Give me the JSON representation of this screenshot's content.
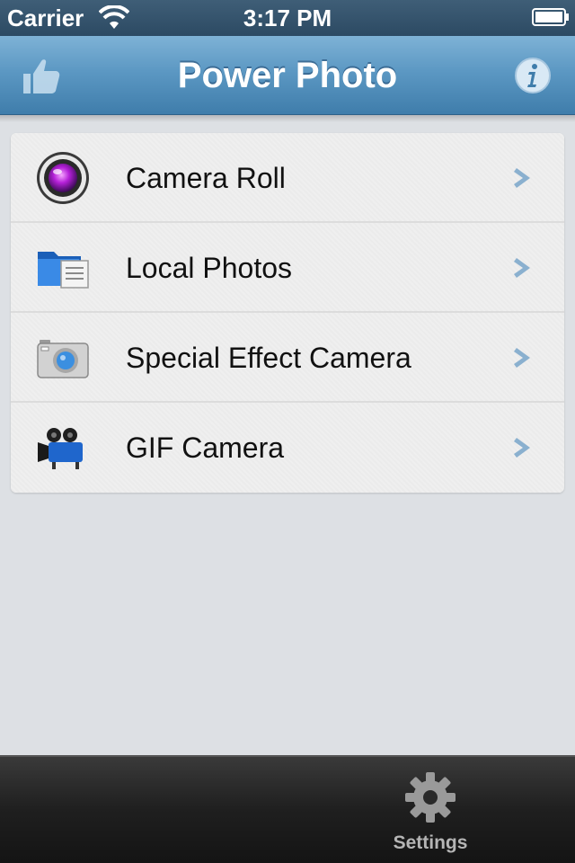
{
  "status_bar": {
    "carrier": "Carrier",
    "time": "3:17 PM"
  },
  "nav_bar": {
    "title": "Power Photo",
    "left_icon": "thumbs-up-icon",
    "right_icon": "info-icon"
  },
  "menu": {
    "items": [
      {
        "label": "Camera Roll",
        "icon": "camera-lens-icon"
      },
      {
        "label": "Local Photos",
        "icon": "folder-icon"
      },
      {
        "label": "Special Effect Camera",
        "icon": "camera-icon"
      },
      {
        "label": "GIF Camera",
        "icon": "video-camera-icon"
      }
    ]
  },
  "tab_bar": {
    "settings_label": "Settings",
    "settings_icon": "gear-icon"
  },
  "colors": {
    "nav_accent": "#5c98c3",
    "background": "#dde0e4",
    "chevron": "#8ab0cf"
  }
}
